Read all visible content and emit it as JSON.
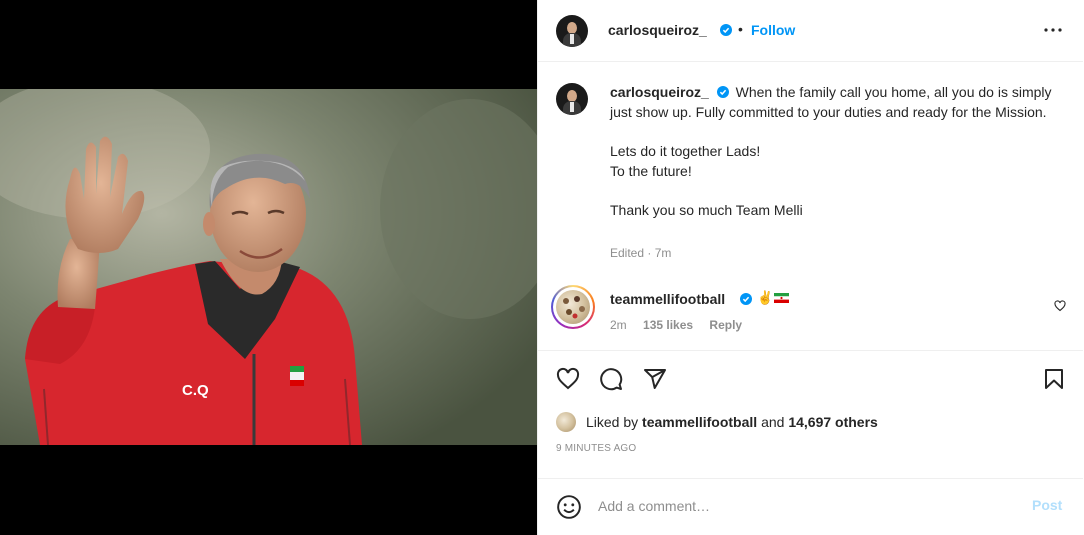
{
  "post": {
    "author": "carlosqueiroz_",
    "follow_label": "Follow",
    "dot": "•",
    "caption_paragraphs": [
      [
        "When the family call you home, all you do is simply just show up. Fully committed to your duties and ready for the Mission."
      ],
      [
        "Lets do it together Lads!",
        "To the future!"
      ],
      [
        "Thank you so much Team Melli"
      ]
    ],
    "edited": "Edited · 7m",
    "likes_prefix": "Liked by",
    "likes_user": "teammellifootball",
    "likes_and": "and",
    "likes_others": "14,697 others",
    "timestamp": "9 minutes ago"
  },
  "comment": {
    "author": "teammellifootball",
    "emoji": "✌",
    "time": "2m",
    "likes": "135 likes",
    "reply": "Reply"
  },
  "composer": {
    "placeholder": "Add a comment…",
    "post_label": "Post"
  },
  "icons": {
    "verified": "verified-badge-icon",
    "more": "more-options-icon",
    "like": "heart-icon",
    "comment": "comment-icon",
    "share": "share-icon",
    "save": "bookmark-icon",
    "emoji": "emoji-icon"
  },
  "colors": {
    "link_blue": "#0095f6",
    "post_disabled": "#b2dffc",
    "secondary_text": "#8e8e8e",
    "jersey_red": "#d7262e"
  }
}
